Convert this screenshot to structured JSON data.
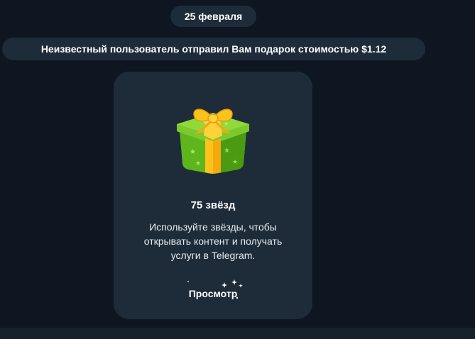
{
  "date_label": "25 февраля",
  "service_message": "Неизвестный пользователь отправил Вам подарок стоимостью $1.12",
  "gift_card": {
    "title": "75 звёзд",
    "description": "Используйте звёзды, чтобы открывать контент и получать услуги в Telegram.",
    "button_label": "Просмотр",
    "icon": "gift-box-icon"
  },
  "colors": {
    "background": "#0e1621",
    "bubble": "#1e2c3a",
    "gift_green": "#7fcf2a",
    "ribbon_yellow": "#ffc21a"
  }
}
